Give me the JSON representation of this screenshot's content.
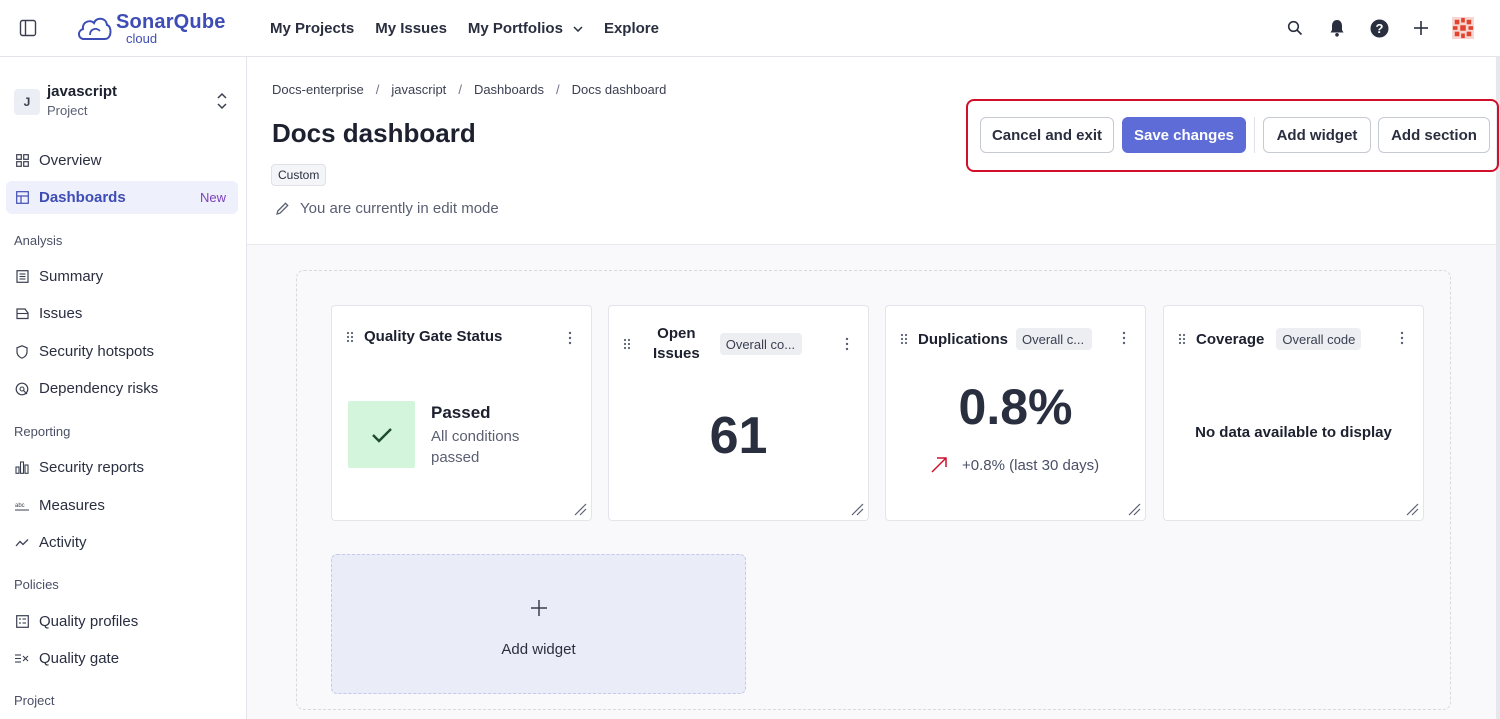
{
  "topbar": {
    "logo_main": "SonarQube",
    "logo_sub": "cloud",
    "nav": [
      "My Projects",
      "My Issues",
      "My Portfolios",
      "Explore"
    ]
  },
  "sidebar": {
    "project": {
      "initial": "J",
      "name": "javascript",
      "type": "Project"
    },
    "items_top": [
      {
        "label": "Overview",
        "icon": "overview-icon"
      },
      {
        "label": "Dashboards",
        "icon": "dashboard-icon",
        "badge": "New"
      }
    ],
    "sections": {
      "analysis": "Analysis",
      "reporting": "Reporting",
      "policies": "Policies",
      "project": "Project"
    },
    "analysis_items": [
      "Summary",
      "Issues",
      "Security hotspots",
      "Dependency risks"
    ],
    "reporting_items": [
      "Security reports",
      "Measures",
      "Activity"
    ],
    "policies_items": [
      "Quality profiles",
      "Quality gate"
    ]
  },
  "breadcrumb": [
    "Docs-enterprise",
    "javascript",
    "Dashboards",
    "Docs dashboard"
  ],
  "page": {
    "title": "Docs dashboard",
    "tag": "Custom",
    "edit_mode_text": "You are currently in edit mode"
  },
  "actions": {
    "cancel": "Cancel and exit",
    "save": "Save changes",
    "add_widget": "Add widget",
    "add_section": "Add section"
  },
  "widgets": {
    "quality_gate": {
      "title": "Quality Gate Status",
      "status": "Passed",
      "detail": "All conditions passed"
    },
    "open_issues": {
      "title_line1": "Open",
      "title_line2": "Issues",
      "tag": "Overall co...",
      "value": "61"
    },
    "duplications": {
      "title": "Duplications",
      "tag": "Overall c...",
      "value": "0.8%",
      "trend": "+0.8% (last 30 days)"
    },
    "coverage": {
      "title": "Coverage",
      "tag": "Overall code",
      "empty": "No data available to display"
    }
  },
  "add_widget_tile": {
    "label": "Add widget"
  },
  "colors": {
    "brand": "#3e4db5",
    "primary_button": "#5d6cd6",
    "highlight_border": "#d0102a",
    "pass_bg": "#d3f5dc",
    "trend_up": "#d0102a"
  }
}
